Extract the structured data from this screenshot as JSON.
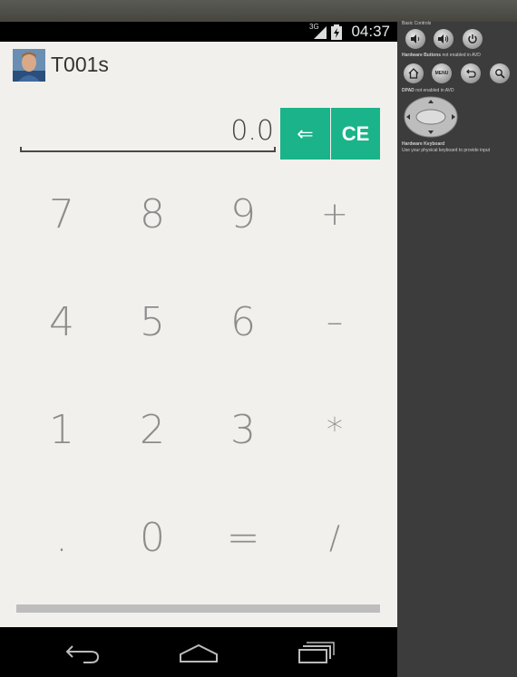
{
  "status_bar": {
    "network": "3G",
    "time": "04:37"
  },
  "app": {
    "title": "T001s"
  },
  "display": {
    "value": "0.0"
  },
  "controls": {
    "backspace_label": "⇐",
    "clear_label": "CE"
  },
  "keypad": {
    "k7": "7",
    "k8": "8",
    "k9": "9",
    "plus": "+",
    "k4": "4",
    "k5": "5",
    "k6": "6",
    "minus": "–",
    "k1": "1",
    "k2": "2",
    "k3": "3",
    "multiply": "*",
    "dot": ".",
    "k0": "0",
    "equals": "=",
    "divide": "/"
  },
  "panel": {
    "basic_controls": "Basic Controls",
    "hardware_buttons": "Hardware Buttons",
    "hardware_buttons_note": "not enabled in AVD",
    "menu_label": "MENU",
    "dpad": "DPAD",
    "dpad_note": "not enabled in AVD",
    "keyboard_title": "Hardware Keyboard",
    "keyboard_note": "Use your physical keyboard to provide input"
  },
  "colors": {
    "accent": "#1bb38a",
    "screen_bg": "#f2f0ec",
    "panel_bg": "#3c3c3c"
  }
}
